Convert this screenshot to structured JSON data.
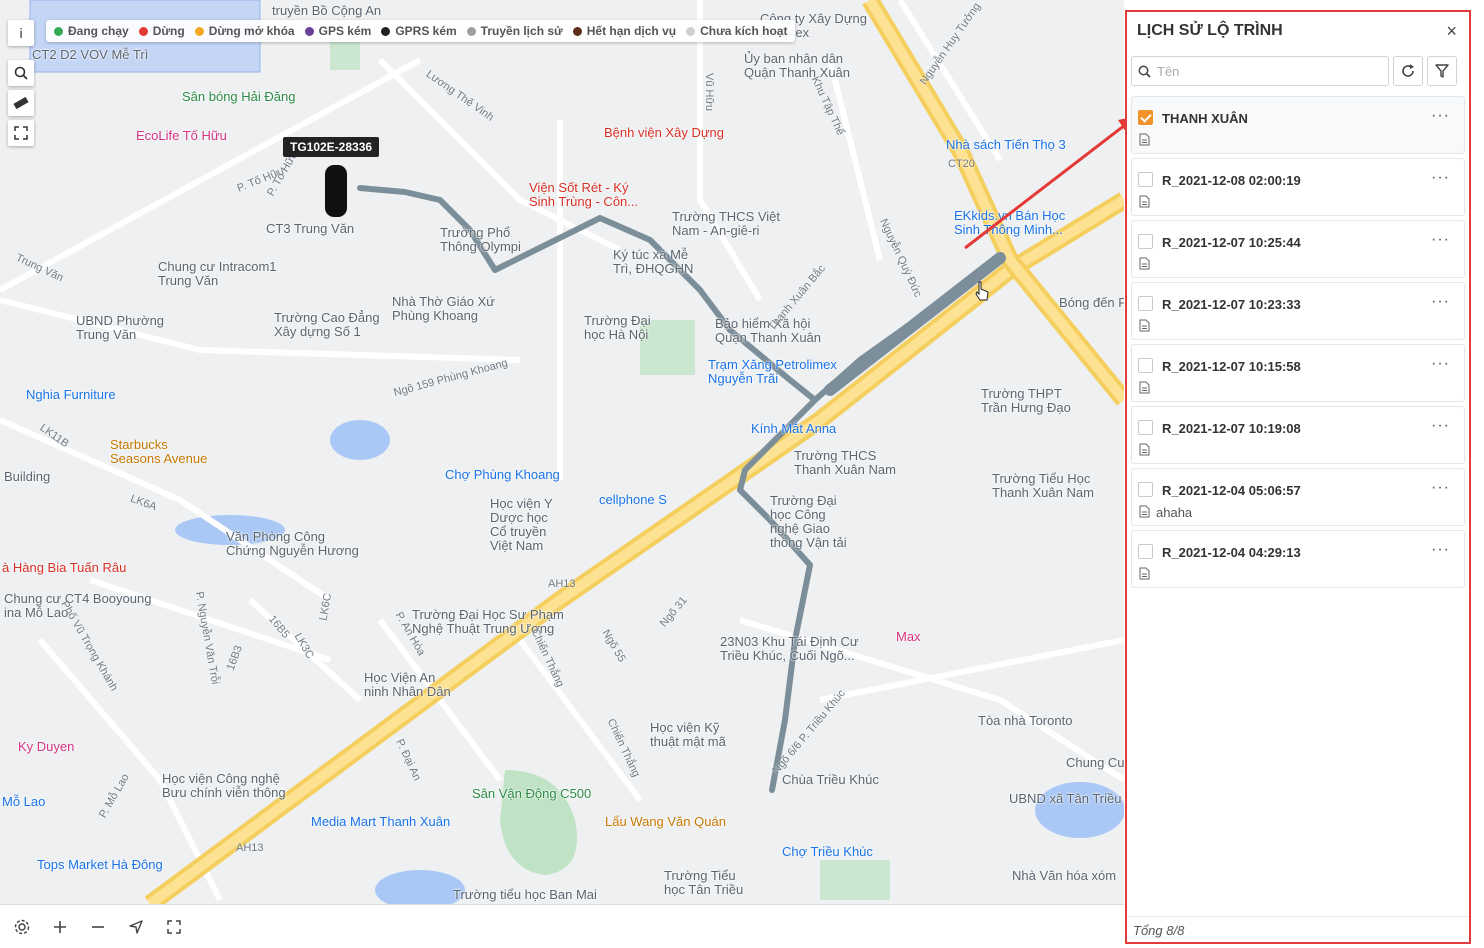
{
  "legend": [
    {
      "label": "Đang chạy",
      "color": "#34a853"
    },
    {
      "label": "Dừng",
      "color": "#e53935"
    },
    {
      "label": "Dừng mở khóa",
      "color": "#f5a623"
    },
    {
      "label": "GPS kém",
      "color": "#6a3d9a"
    },
    {
      "label": "GPRS kém",
      "color": "#222222"
    },
    {
      "label": "Truyền lịch sử",
      "color": "#9e9e9e"
    },
    {
      "label": "Hết hạn dịch vụ",
      "color": "#5d2e1a"
    },
    {
      "label": "Chưa kích hoạt",
      "color": "#d0d0d0"
    }
  ],
  "map_tools": {
    "info": "i"
  },
  "vehicle": {
    "plate": "TG102E-28336"
  },
  "map_labels": [
    {
      "text": "truyền Bồ Cộng An",
      "cls": ""
    },
    {
      "text": "CT2 D2 VOV Mễ Trì",
      "cls": ""
    },
    {
      "text": "Sân bóng Hải Đăng",
      "cls": "green"
    },
    {
      "text": "EcoLife Tố Hữu",
      "cls": "pink"
    },
    {
      "text": "CT3 Trung Văn",
      "cls": ""
    },
    {
      "text": "Chung cư Intracom1\nTrung Văn",
      "cls": ""
    },
    {
      "text": "UBND Phường\nTrung Văn",
      "cls": ""
    },
    {
      "text": "Trường Cao Đẳng\nXây dựng Số 1",
      "cls": ""
    },
    {
      "text": "Nhà Thờ Giáo Xứ\nPhùng Khoang",
      "cls": ""
    },
    {
      "text": "Nghia Furniture",
      "cls": "blue"
    },
    {
      "text": "Starbucks\nSeasons Avenue",
      "cls": "orange"
    },
    {
      "text": "Building",
      "cls": ""
    },
    {
      "text": "Văn Phòng Công\nChứng Nguyễn Hương",
      "cls": ""
    },
    {
      "text": "à Hàng Bia Tuấn Râu",
      "cls": "red"
    },
    {
      "text": "Chung cư CT4 Booyoung\nina Mỗ Lao",
      "cls": ""
    },
    {
      "text": "Ky Duyen",
      "cls": "pink"
    },
    {
      "text": "Mỗ Lao",
      "cls": "blue"
    },
    {
      "text": "Học viện Công nghệ\nBưu chính viễn thông",
      "cls": ""
    },
    {
      "text": "Media Mart Thanh Xuân",
      "cls": "blue"
    },
    {
      "text": "Tops Market Hà Đông",
      "cls": "blue"
    },
    {
      "text": "Học Viện An\nninh Nhân Dân",
      "cls": ""
    },
    {
      "text": "Trường Đại Học Sư Phạm\nNghệ Thuật Trung Ương",
      "cls": ""
    },
    {
      "text": "Học viện Y\nDược học\nCổ truyền\nViệt Nam",
      "cls": ""
    },
    {
      "text": "Chợ Phùng Khoang",
      "cls": "blue"
    },
    {
      "text": "cellphone S",
      "cls": "blue"
    },
    {
      "text": "Trường Đại\nhọc Hà Nội",
      "cls": ""
    },
    {
      "text": "Trường Phổ\nThông Olympi",
      "cls": ""
    },
    {
      "text": "Viện Sốt Rét - Ký\nSinh Trùng - Côn...",
      "cls": "red"
    },
    {
      "text": "Bệnh viện Xây Dựng",
      "cls": "red"
    },
    {
      "text": "Trường THCS Việt\nNam - An-giê-ri",
      "cls": ""
    },
    {
      "text": "Ký túc xá Mễ\nTrì, ĐHQGHN",
      "cls": ""
    },
    {
      "text": "Bảo hiểm Xã hội\nQuận Thanh Xuân",
      "cls": ""
    },
    {
      "text": "Trạm Xăng Petrolimex\nNguyễn Trãi",
      "cls": "blue"
    },
    {
      "text": "Kính Mắt Anna",
      "cls": "blue"
    },
    {
      "text": "Trường THCS\nThanh Xuân Nam",
      "cls": ""
    },
    {
      "text": "Trường Đại\nhọc Công\nnghệ Giao\nthông Vận tải",
      "cls": ""
    },
    {
      "text": "23N03 Khu Tái Định Cư\nTriều Khúc, Cuối Ngõ...",
      "cls": ""
    },
    {
      "text": "Max",
      "cls": "pink"
    },
    {
      "text": "Học viện Kỹ\nthuật mật mã",
      "cls": ""
    },
    {
      "text": "Sân Vận Động C500",
      "cls": "green"
    },
    {
      "text": "Lẩu Wang Văn Quán",
      "cls": "orange"
    },
    {
      "text": "Chùa Triều Khúc",
      "cls": ""
    },
    {
      "text": "Chợ Triều Khúc",
      "cls": "blue"
    },
    {
      "text": "Trường tiểu học Ban Mai",
      "cls": ""
    },
    {
      "text": "Trường Tiểu\nhọc Tân Triều",
      "cls": ""
    },
    {
      "text": "Nhà Văn hóa xóm",
      "cls": ""
    },
    {
      "text": "UBND xã Tân Triều",
      "cls": ""
    },
    {
      "text": "Chung Cư",
      "cls": ""
    },
    {
      "text": "Tòa nhà Toronto",
      "cls": ""
    },
    {
      "text": "Trường Tiểu Học\nThanh Xuân Nam",
      "cls": ""
    },
    {
      "text": "Trường THPT\nTrần Hưng Đạo",
      "cls": ""
    },
    {
      "text": "Bóng đến F",
      "cls": ""
    },
    {
      "text": "EKkids.vn Bán Học\nSinh Thông Minh...",
      "cls": "blue"
    },
    {
      "text": "Nhà sách Tiến Thọ 3",
      "cls": "blue"
    },
    {
      "text": "Ủy ban nhân dân\nQuận Thanh Xuân",
      "cls": ""
    },
    {
      "text": "Công ty Xây Dựng\nnaconex",
      "cls": ""
    }
  ],
  "road_labels": [
    "P. Tố Hữu",
    "P. Tố Hữu",
    "Lương Thế Vinh",
    "Trung Văn",
    "Ngõ 159 Phùng Khoang",
    "Vũ Hữu",
    "Khu Tập Thể",
    "Nguyễn Huy Tưởng",
    "Thanh Xuân Bắc",
    "Nguyễn Quý Đức",
    "AH13",
    "AH13",
    "LK11B",
    "LK6A",
    "LK6C",
    "16B5",
    "LK3C",
    "16B3",
    "P. An Hòa",
    "Chiến Thắng",
    "Chiến Thắng",
    "Ngõ 55",
    "Ngõ 31",
    "P. Đại An",
    "P. Nguyễn Văn Trỗi",
    "Phố Vũ Trọng Khánh",
    "P. Mỗ Lao",
    "Ngõ 6/6 P. Triều Khúc",
    "CT20"
  ],
  "panel": {
    "title": "LỊCH SỬ LỘ TRÌNH",
    "close": "×",
    "search_placeholder": "Tên",
    "footer": "Tổng 8/8",
    "items": [
      {
        "name": "THANH XUÂN",
        "checked": true,
        "note": ""
      },
      {
        "name": "R_2021-12-08 02:00:19",
        "checked": false,
        "note": ""
      },
      {
        "name": "R_2021-12-07 10:25:44",
        "checked": false,
        "note": ""
      },
      {
        "name": "R_2021-12-07 10:23:33",
        "checked": false,
        "note": ""
      },
      {
        "name": "R_2021-12-07 10:15:58",
        "checked": false,
        "note": ""
      },
      {
        "name": "R_2021-12-07 10:19:08",
        "checked": false,
        "note": ""
      },
      {
        "name": "R_2021-12-04 05:06:57",
        "checked": false,
        "note": "ahaha"
      },
      {
        "name": "R_2021-12-04 04:29:13",
        "checked": false,
        "note": ""
      }
    ]
  }
}
